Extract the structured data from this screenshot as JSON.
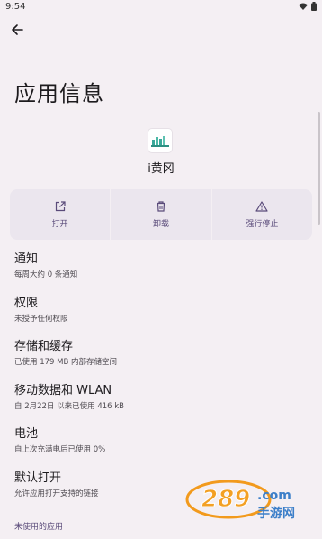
{
  "status_bar": {
    "time": "9:54"
  },
  "header": {
    "title": "应用信息"
  },
  "app": {
    "name": "i黄冈"
  },
  "actions": [
    {
      "label": "打开",
      "icon": "open-external-icon"
    },
    {
      "label": "卸载",
      "icon": "trash-icon"
    },
    {
      "label": "强行停止",
      "icon": "warning-icon"
    }
  ],
  "settings": [
    {
      "title": "通知",
      "subtitle": "每周大约 0 条通知"
    },
    {
      "title": "权限",
      "subtitle": "未授予任何权限"
    },
    {
      "title": "存储和缓存",
      "subtitle": "已使用 179 MB 内部存储空间"
    },
    {
      "title": "移动数据和 WLAN",
      "subtitle": "自 2月22日 以来已使用 416 kB"
    },
    {
      "title": "电池",
      "subtitle": "自上次充满电后已使用 0%"
    },
    {
      "title": "默认打开",
      "subtitle": "允许应用打开支持的链接"
    }
  ],
  "footer": {
    "unused_apps_label": "未使用的应用"
  },
  "watermark": {
    "text": "289.com 手游网"
  },
  "colors": {
    "background": "#f4eff3",
    "accent": "#5a4b7a",
    "card": "#ebe6ee"
  }
}
